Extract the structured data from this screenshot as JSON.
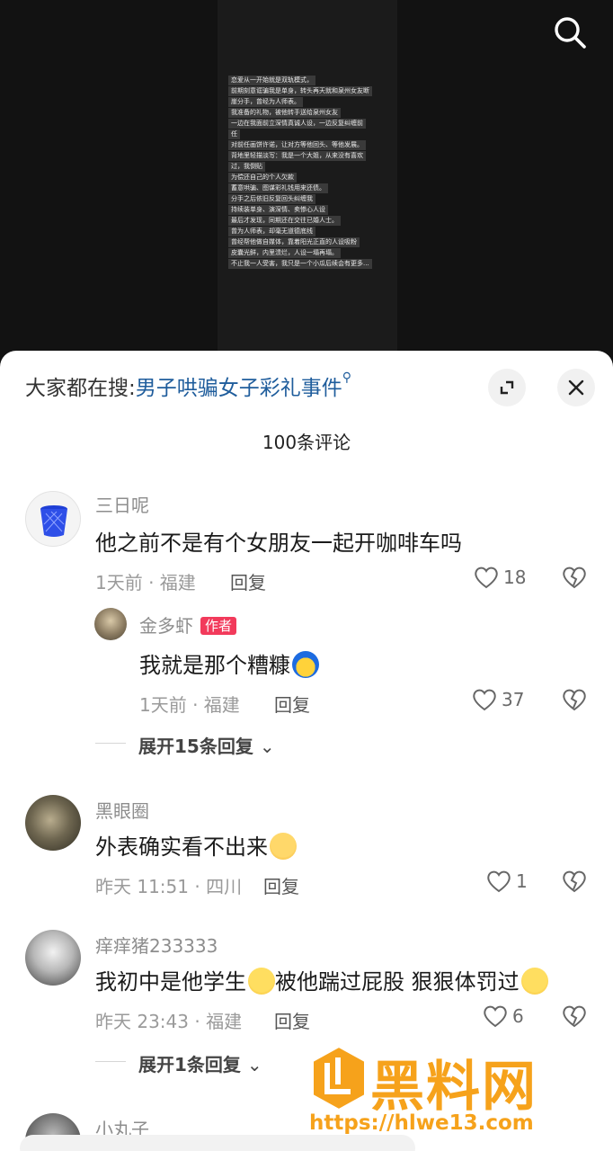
{
  "video": {
    "overlay_lines": [
      "恋爱从一开始就是双轨模式，",
      "前期刻意诓骗我是单身，转头再天就和泉州女友断",
      "崖分手，曾经为人师表。",
      "我准备的礼物，被他转手送给泉州女友",
      "一边在我面前立深情真诚人设，一边反复纠缠前",
      "任",
      "对前任画饼许诺，让对方等他回头、等他发展。",
      "背地里轻描淡写：我是一个大姐，从来没有喜欢",
      "过，我倒贴",
      "为偿还自己的个人欠款",
      "蓄意哄骗、图谋彩礼钱用来还债。",
      "分手之后依旧反复回头纠缠我",
      "持续装单身、演深情、卖惨心人设",
      "最后才发现，同期还在交往已婚人士。",
      "曾为人师表，却毫无道德底线",
      "曾经帮他做自媒体，靠着阳光正直的人设吸粉",
      "皮囊光鲜，内里溃烂，人设一塌再塌。",
      "不止我一人受害，我只是一个小瓜后续会有更多..."
    ]
  },
  "sheet": {
    "hot_prefix": "大家都在搜:",
    "hot_query": "男子哄骗女子彩礼事件",
    "comment_count": "100条评论"
  },
  "comments": [
    {
      "user": "三日呢",
      "text": "他之前不是有个女朋友一起开咖啡车吗",
      "meta": "1天前 · 福建",
      "reply": "回复",
      "likes": "18"
    },
    {
      "user": "金多虾",
      "badge": "作者",
      "text": "我就是那个糟糠",
      "meta": "1天前 · 福建",
      "reply": "回复",
      "likes": "37"
    },
    {
      "user": "黑眼圈",
      "text": "外表确实看不出来",
      "meta": "昨天 11:51 · 四川",
      "reply": "回复",
      "likes": "1"
    },
    {
      "user": "痒痒猪233333",
      "text_a": "我初中是他学生",
      "text_b": "被他踹过屁股 狠狠体罚过",
      "meta": "昨天 23:43 · 福建",
      "reply": "回复",
      "likes": "6"
    },
    {
      "user": "小丸子"
    }
  ],
  "expand_1": "展开15条回复",
  "expand_2": "展开1条回复",
  "watermark": {
    "title": "黑料网",
    "url": "https://hlwe13.com"
  },
  "colors": {
    "link": "#1f5d9c",
    "author_badge": "#f23a5b",
    "watermark": "#f6a21b"
  }
}
